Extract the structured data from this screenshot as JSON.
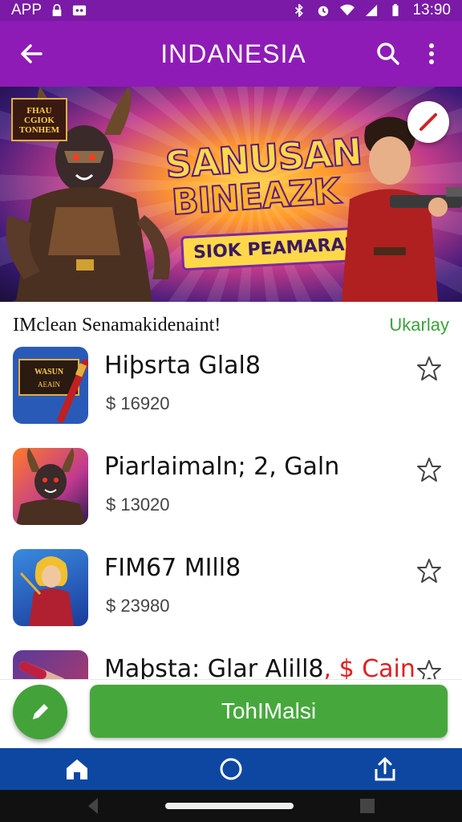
{
  "status_bar": {
    "app_label": "APP",
    "time": "13:90"
  },
  "app_bar": {
    "title": "INDANESIA"
  },
  "banner": {
    "badge_text": "FHAU\nCGIOK\nTONHEM",
    "headline_line1": "SANUSAN",
    "headline_line2": "BINEAZK",
    "subline": "SIOK PEAMARAIN"
  },
  "section": {
    "title": "IMclean Senamakidenaint!",
    "link": "Ukarlay"
  },
  "items": [
    {
      "name": "Hiþsrta Glal8",
      "name_red": "",
      "price": "$ 16920",
      "thumb": "poster-sword"
    },
    {
      "name": "Piarlaimaln; 2, Galn",
      "name_red": "",
      "price": "$ 13020",
      "thumb": "demon-warrior"
    },
    {
      "name": "FIM67 MIll8",
      "name_red": "",
      "price": "$ 23980",
      "thumb": "heroine-blonde"
    },
    {
      "name": "Maþsta: Glar Alill8",
      "name_red": ", $ Cain",
      "price": "",
      "thumb": "scroll-red"
    }
  ],
  "actions": {
    "primary_label": "TohIMalsi"
  },
  "icons": {
    "back": "arrow-left-icon",
    "search": "search-icon",
    "more": "more-vert-icon",
    "star": "star-outline-icon",
    "edit": "pencil-icon",
    "home": "home-icon",
    "circle": "circle-icon",
    "share": "share-icon"
  },
  "colors": {
    "app_bar": "#8e1bb5",
    "status_bar": "#7a1aa6",
    "accent_green": "#46a83c",
    "bottom_nav": "#0d47a1"
  }
}
